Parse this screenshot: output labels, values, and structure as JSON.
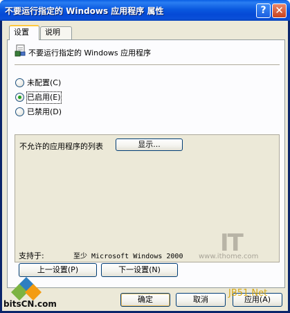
{
  "window": {
    "title": "不要运行指定的 Windows 应用程序 属性"
  },
  "titlebar": {
    "help_glyph": "?",
    "close_glyph": "✕"
  },
  "tabs": [
    {
      "label": "设置"
    },
    {
      "label": "说明"
    }
  ],
  "policy": {
    "name": "不要运行指定的 Windows 应用程序"
  },
  "state": {
    "options": [
      {
        "label": "未配置(C)",
        "checked": false
      },
      {
        "label": "已启用(E)",
        "checked": true
      },
      {
        "label": "已禁用(D)",
        "checked": false
      }
    ]
  },
  "options": {
    "list_label": "不允许的应用程序的列表",
    "show_button": "显示..."
  },
  "supported": {
    "label": "支持于:",
    "value": "至少 Microsoft Windows 2000"
  },
  "nav": {
    "prev": "上一设置(P)",
    "next": "下一设置(N)"
  },
  "dialog": {
    "ok": "确定",
    "cancel": "取消",
    "apply": "应用(A)"
  },
  "watermarks": {
    "ithome_logo": "IT之家",
    "ithome_url": "www.ithome.com",
    "bitscn": "bitsCN.com",
    "jb51": "JB51.Net"
  },
  "colors": {
    "titlebar": "#0a58df",
    "dialog_bg": "#ece9d8",
    "tab_highlight": "#ffc83c",
    "radio_dot": "#21a121"
  }
}
